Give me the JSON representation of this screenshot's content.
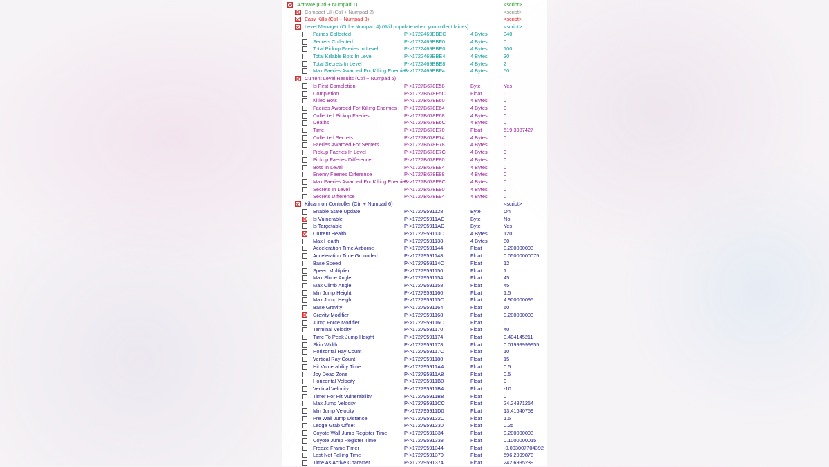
{
  "colors": {
    "activate": "#1e9a1e",
    "compact": "#8a8a8a",
    "easy": "#e02424",
    "level": "#0c9a9a",
    "results": "#961c96",
    "kilcannon": "#1c1c88"
  },
  "table": {
    "desc": "Activate (Ctrl + Numpad 1)",
    "value": "<script>",
    "checked": true,
    "color": "activate",
    "children": [
      {
        "desc": "Compact UI (Ctrl + Numpad 2)",
        "value": "<script>",
        "checked": true,
        "color": "compact"
      },
      {
        "desc": "Easy Kills (Ctrl + Numpad 3)",
        "value": "<script>",
        "checked": true,
        "color": "easy"
      },
      {
        "desc": "Level Manager (Ctrl + Numpad 4) (Will populate when you collect fairies)",
        "value": "<script>",
        "checked": true,
        "color": "level",
        "children": [
          {
            "desc": "Fairies Collected",
            "address": "P->1722469BBEC",
            "type": "4 Bytes",
            "value": "340",
            "checked": false
          },
          {
            "desc": "Secrets Collected",
            "address": "P->1722469BBF0",
            "type": "4 Bytes",
            "value": "0",
            "checked": false
          },
          {
            "desc": "Total Pickup Faeries In Level",
            "address": "P->1722469BBE0",
            "type": "4 Bytes",
            "value": "100",
            "checked": false
          },
          {
            "desc": "Total Killable Bots In Level",
            "address": "P->1722469BBE4",
            "type": "4 Bytes",
            "value": "30",
            "checked": false
          },
          {
            "desc": "Total Secrets In Level",
            "address": "P->1722469BBE8",
            "type": "4 Bytes",
            "value": "2",
            "checked": false
          },
          {
            "desc": "Max Faeries Awarded For Killing Enemies",
            "address": "P->1722469BBF4",
            "type": "4 Bytes",
            "value": "50",
            "checked": false
          }
        ]
      },
      {
        "desc": "Current Level Results (Ctrl + Numpad 5)",
        "value": "",
        "checked": true,
        "color": "results",
        "children": [
          {
            "desc": "Is First Completion",
            "address": "P->1727B678E58",
            "type": "Byte",
            "value": "Yes",
            "checked": false
          },
          {
            "desc": "Completion",
            "address": "P->1727B678E5C",
            "type": "Float",
            "value": "0",
            "checked": false
          },
          {
            "desc": "Killed Bots",
            "address": "P->1727B678E60",
            "type": "4 Bytes",
            "value": "0",
            "checked": false
          },
          {
            "desc": "Faeries Awarded For Killing Enemies",
            "address": "P->1727B678E64",
            "type": "4 Bytes",
            "value": "0",
            "checked": false
          },
          {
            "desc": "Collected Pickup Faeries",
            "address": "P->1727B678E68",
            "type": "4 Bytes",
            "value": "0",
            "checked": false
          },
          {
            "desc": "Deaths",
            "address": "P->1727B678E6C",
            "type": "4 Bytes",
            "value": "0",
            "checked": false
          },
          {
            "desc": "Time",
            "address": "P->1727B678E70",
            "type": "Float",
            "value": "519.3987427",
            "checked": false
          },
          {
            "desc": "Collected Secrets",
            "address": "P->1727B678E74",
            "type": "4 Bytes",
            "value": "0",
            "checked": false
          },
          {
            "desc": "Faeries Awarded For Secrets",
            "address": "P->1727B678E78",
            "type": "4 Bytes",
            "value": "0",
            "checked": false
          },
          {
            "desc": "Pickup Faeries In Level",
            "address": "P->1727B678E7C",
            "type": "4 Bytes",
            "value": "0",
            "checked": false
          },
          {
            "desc": "Pickup Faeries Difference",
            "address": "P->1727B678E80",
            "type": "4 Bytes",
            "value": "0",
            "checked": false
          },
          {
            "desc": "Bots In Level",
            "address": "P->1727B678E84",
            "type": "4 Bytes",
            "value": "0",
            "checked": false
          },
          {
            "desc": "Enemy Faeries Difference",
            "address": "P->1727B678E88",
            "type": "4 Bytes",
            "value": "0",
            "checked": false
          },
          {
            "desc": "Max Faeries Awarded For Killing Enemies",
            "address": "P->1727B678E8C",
            "type": "4 Bytes",
            "value": "0",
            "checked": false
          },
          {
            "desc": "Secrets In Level",
            "address": "P->1727B678E90",
            "type": "4 Bytes",
            "value": "0",
            "checked": false
          },
          {
            "desc": "Secrets Difference",
            "address": "P->1727B678E94",
            "type": "4 Bytes",
            "value": "0",
            "checked": false
          }
        ]
      },
      {
        "desc": "Kilcannon Controller (Ctrl + Numpad 6)",
        "value": "<script>",
        "checked": true,
        "color": "kilcannon",
        "children": [
          {
            "desc": "Enable State Update",
            "address": "P->17279591128",
            "type": "Byte",
            "value": "On",
            "checked": false
          },
          {
            "desc": "Is Vulnerable",
            "address": "P->172795911AC",
            "type": "Byte",
            "value": "No",
            "checked": true
          },
          {
            "desc": "Is Targetable",
            "address": "P->172795911AD",
            "type": "Byte",
            "value": "Yes",
            "checked": false
          },
          {
            "desc": "Current Health",
            "address": "P->1727959113C",
            "type": "4 Bytes",
            "value": "120",
            "checked": true
          },
          {
            "desc": "Max Health",
            "address": "P->17279591138",
            "type": "4 Bytes",
            "value": "80",
            "checked": false
          },
          {
            "desc": "Acceleration Time Airborne",
            "address": "P->17279591144",
            "type": "Float",
            "value": "0.200000003",
            "checked": false
          },
          {
            "desc": "Acceleration Time Grounded",
            "address": "P->17279591148",
            "type": "Float",
            "value": "0.05000000075",
            "checked": false
          },
          {
            "desc": "Base Speed",
            "address": "P->1727959114C",
            "type": "Float",
            "value": "12",
            "checked": false
          },
          {
            "desc": "Speed Multiplier",
            "address": "P->17279591150",
            "type": "Float",
            "value": "1",
            "checked": false
          },
          {
            "desc": "Max Slope Angle",
            "address": "P->17279591154",
            "type": "Float",
            "value": "45",
            "checked": false
          },
          {
            "desc": "Max Climb Angle",
            "address": "P->17279591158",
            "type": "Float",
            "value": "45",
            "checked": false
          },
          {
            "desc": "Min Jump Height",
            "address": "P->17279591160",
            "type": "Float",
            "value": "1.5",
            "checked": false
          },
          {
            "desc": "Max Jump Height",
            "address": "P->1727959115C",
            "type": "Float",
            "value": "4.900000095",
            "checked": false
          },
          {
            "desc": "Base Gravity",
            "address": "P->17279591164",
            "type": "Float",
            "value": "60",
            "checked": false
          },
          {
            "desc": "Gravity Modifier",
            "address": "P->17279591168",
            "type": "Float",
            "value": "0.200000003",
            "checked": true
          },
          {
            "desc": "Jump Force Modifier",
            "address": "P->1727959116C",
            "type": "Float",
            "value": "0",
            "checked": false
          },
          {
            "desc": "Terminal Velocity",
            "address": "P->17279591170",
            "type": "Float",
            "value": "40",
            "checked": false
          },
          {
            "desc": "Time To Peak Jump Height",
            "address": "P->17279591174",
            "type": "Float",
            "value": "0.404145211",
            "checked": false
          },
          {
            "desc": "Skin Width",
            "address": "P->17279591178",
            "type": "Float",
            "value": "0.01999999955",
            "checked": false
          },
          {
            "desc": "Horizontal Ray Count",
            "address": "P->1727959117C",
            "type": "Float",
            "value": "10",
            "checked": false
          },
          {
            "desc": "Vertical Ray Count",
            "address": "P->17279591180",
            "type": "Float",
            "value": "15",
            "checked": false
          },
          {
            "desc": "Hit Vulnerability Time",
            "address": "P->172795911A4",
            "type": "Float",
            "value": "0.5",
            "checked": false
          },
          {
            "desc": "Joy Dead Zone",
            "address": "P->172795911A8",
            "type": "Float",
            "value": "0.5",
            "checked": false
          },
          {
            "desc": "Horizontal Velocity",
            "address": "P->172795911B0",
            "type": "Float",
            "value": "0",
            "checked": false
          },
          {
            "desc": "Vertical Velocity",
            "address": "P->172795911B4",
            "type": "Float",
            "value": "-10",
            "checked": false
          },
          {
            "desc": "Timer For Hit Vulnerability",
            "address": "P->172795911B8",
            "type": "Float",
            "value": "0",
            "checked": false
          },
          {
            "desc": "Max Jump Velocity",
            "address": "P->172795911CC",
            "type": "Float",
            "value": "24.24871254",
            "checked": false
          },
          {
            "desc": "Min Jump Velocity",
            "address": "P->172795911D0",
            "type": "Float",
            "value": "13.41640759",
            "checked": false
          },
          {
            "desc": "Pre Wall Jump Distance",
            "address": "P->1727959132C",
            "type": "Float",
            "value": "1.5",
            "checked": false
          },
          {
            "desc": "Ledge Grab Offset",
            "address": "P->17279591330",
            "type": "Float",
            "value": "0.25",
            "checked": false
          },
          {
            "desc": "Coyote Wall Jump Register Time",
            "address": "P->17279591334",
            "type": "Float",
            "value": "0.200000003",
            "checked": false
          },
          {
            "desc": "Coyote Jump Register Time",
            "address": "P->17279591338",
            "type": "Float",
            "value": "0.1000000015",
            "checked": false
          },
          {
            "desc": "Freeze Frame Timer",
            "address": "P->17279591344",
            "type": "Float",
            "value": "-0.003007704392",
            "checked": false
          },
          {
            "desc": "Last Not Falling Time",
            "address": "P->17279591370",
            "type": "Float",
            "value": "596.2999878",
            "checked": false
          },
          {
            "desc": "Time As Active Character",
            "address": "P->17279591374",
            "type": "Float",
            "value": "242.6995239",
            "checked": false
          }
        ]
      }
    ]
  }
}
